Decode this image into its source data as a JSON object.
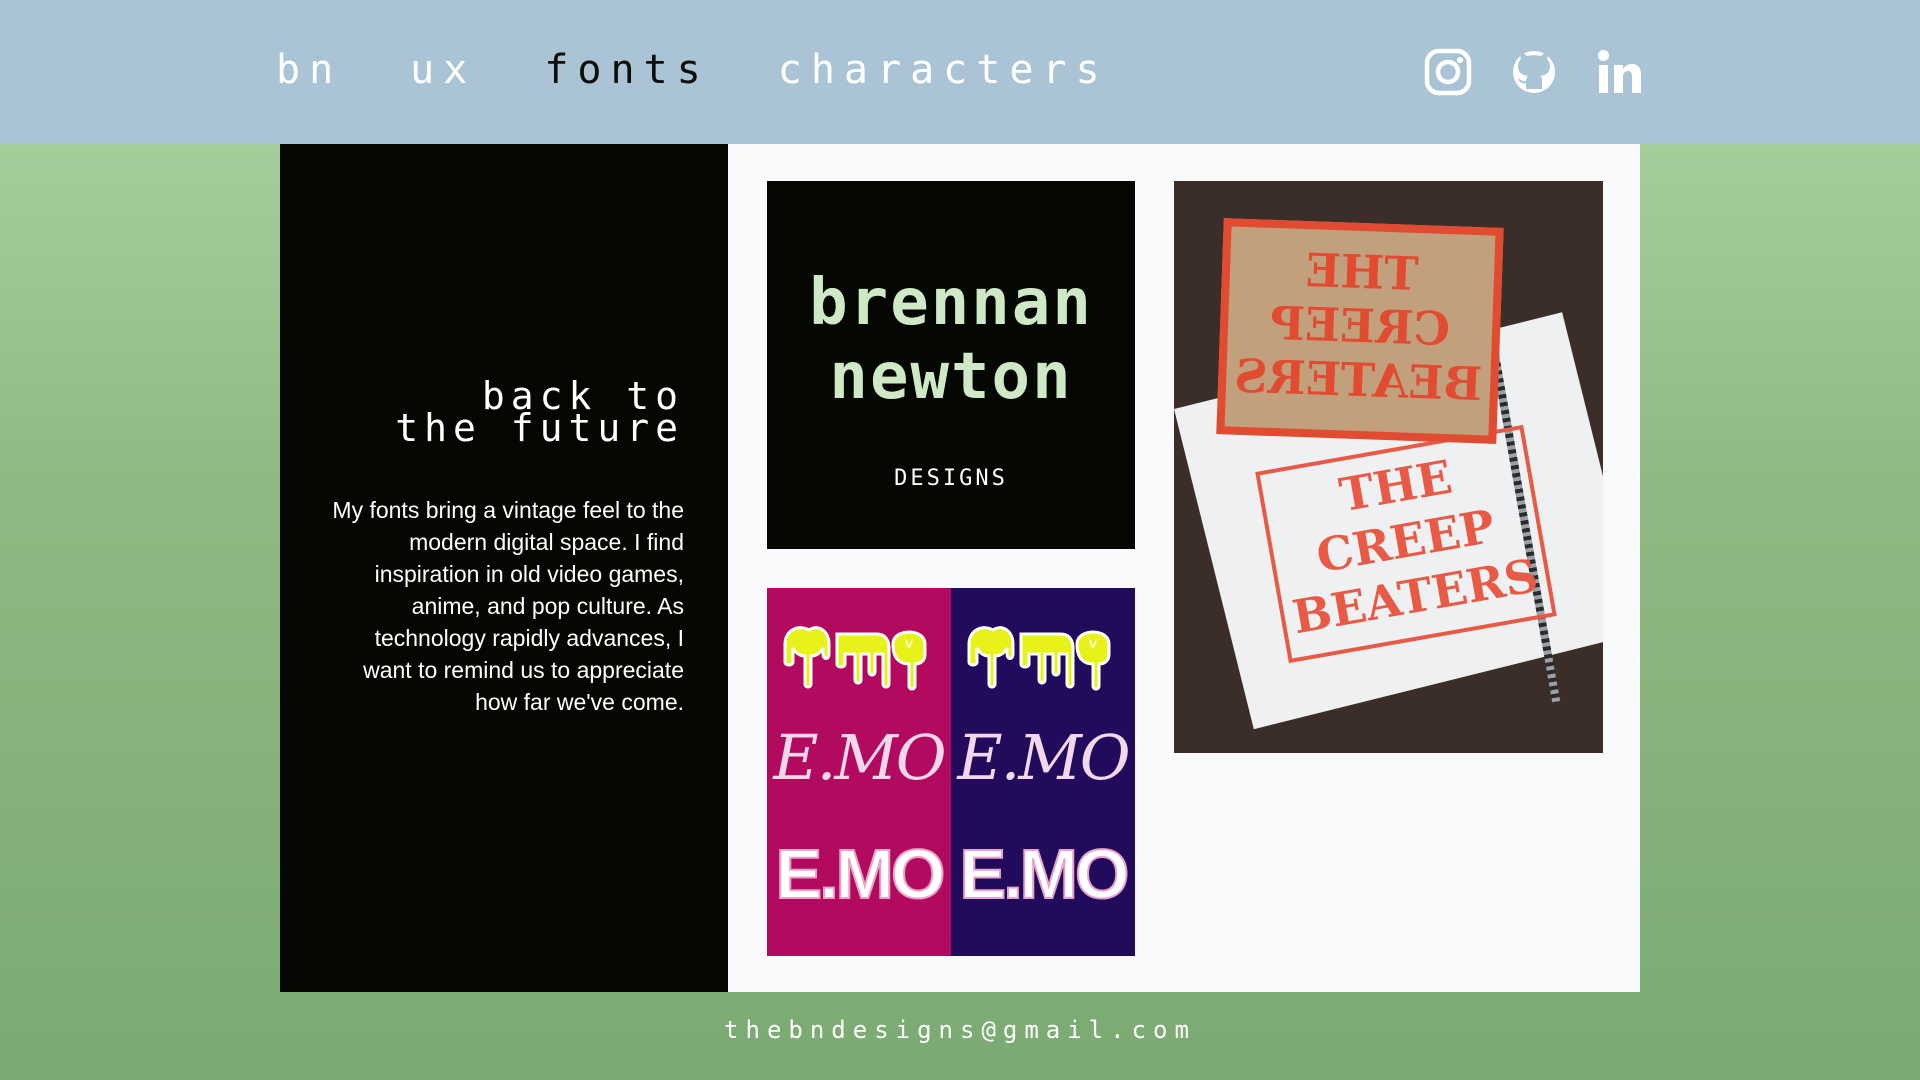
{
  "nav": {
    "items": [
      {
        "label": "bn",
        "active": false
      },
      {
        "label": "ux",
        "active": false
      },
      {
        "label": "fonts",
        "active": true
      },
      {
        "label": "characters",
        "active": false
      }
    ]
  },
  "social": {
    "instagram_icon": "instagram-icon",
    "github_icon": "github-icon",
    "linkedin_icon": "linkedin-icon"
  },
  "feature": {
    "title_line1": "back to",
    "title_line2": "the future",
    "body": "My fonts bring a vintage feel to the modern digital space. I find inspiration in old video games, anime, and pop culture. As technology rapidly advances, I want to remind us to appreciate how far we've come."
  },
  "logo_card": {
    "line1": "brennan",
    "line2": "newton",
    "line3": "DESIGNS"
  },
  "emo_card": {
    "drip_text": "e.mo",
    "script_text": "E.MO",
    "block_text": "E.MO"
  },
  "photo_card": {
    "block_text_line1": "THE",
    "block_text_line2": "CREEP",
    "block_text_line3": "BEATERS",
    "print_text_line1": "THE",
    "print_text_line2": "CREEP",
    "print_text_line3": "BEATERS"
  },
  "footer": {
    "email": "thebndesigns@gmail.com"
  },
  "colors": {
    "header_bg": "#aac4d5",
    "panel_bg": "#f9fafb",
    "black": "#050703",
    "emo_magenta": "#b20a5e",
    "emo_purple": "#220a5d",
    "stamp_red": "#e04b32"
  }
}
